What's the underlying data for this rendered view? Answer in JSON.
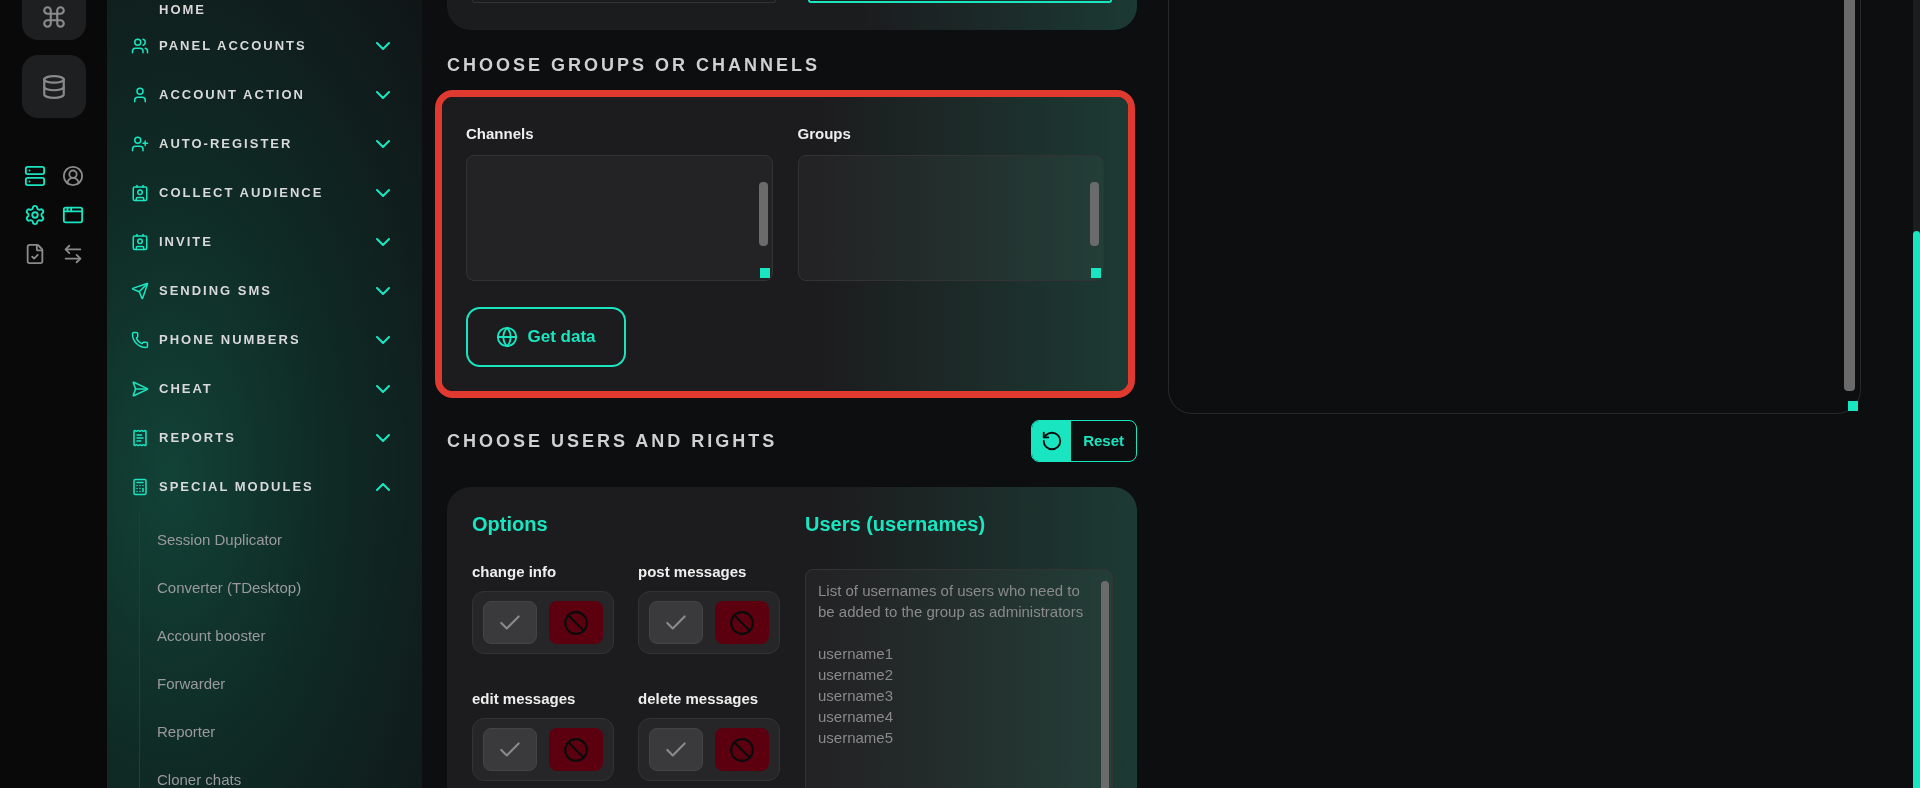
{
  "rail": {
    "tools": [
      {
        "kind": "server",
        "active": true
      },
      {
        "kind": "user",
        "active": false
      },
      {
        "kind": "settings",
        "active": true
      },
      {
        "kind": "code",
        "active": true
      },
      {
        "kind": "document",
        "active": false
      },
      {
        "kind": "swap",
        "active": false
      }
    ]
  },
  "sidebar": {
    "home": "HOME",
    "items": [
      {
        "kind": "users",
        "label": "PANEL ACCOUNTS",
        "expanded": false
      },
      {
        "kind": "user",
        "label": "ACCOUNT ACTION",
        "expanded": false
      },
      {
        "kind": "user-plus",
        "label": "AUTO-REGISTER",
        "expanded": false
      },
      {
        "kind": "audience",
        "label": "COLLECT AUDIENCE",
        "expanded": false
      },
      {
        "kind": "audience",
        "label": "INVITE",
        "expanded": false
      },
      {
        "kind": "send",
        "label": "SENDING SMS",
        "expanded": false
      },
      {
        "kind": "phone",
        "label": "PHONE NUMBERS",
        "expanded": false
      },
      {
        "kind": "send-plus",
        "label": "CHEAT",
        "expanded": false
      },
      {
        "kind": "report",
        "label": "REPORTS",
        "expanded": false
      },
      {
        "kind": "modules",
        "label": "SPECIAL MODULES",
        "expanded": true,
        "children": [
          {
            "label": "Session Duplicator"
          },
          {
            "label": "Converter (TDesktop)"
          },
          {
            "label": "Account booster"
          },
          {
            "label": "Forwarder"
          },
          {
            "label": "Reporter"
          },
          {
            "label": "Cloner chats"
          }
        ]
      }
    ]
  },
  "groups_section": {
    "heading": "CHOOSE GROUPS OR CHANNELS",
    "highlighted": true,
    "fields": [
      {
        "label": "Channels"
      },
      {
        "label": "Groups"
      }
    ],
    "button": "Get data"
  },
  "users_section": {
    "heading": "CHOOSE USERS AND RIGHTS",
    "reset": "Reset",
    "options_title": "Options",
    "options": [
      {
        "label": "change info",
        "allowed": false
      },
      {
        "label": "post messages",
        "allowed": false
      },
      {
        "label": "edit messages",
        "allowed": false
      },
      {
        "label": "delete messages",
        "allowed": false
      }
    ],
    "users_title": "Users (usernames)",
    "users_placeholder": "List of usernames of users who need to be added to the group as administrators\n\nusername1\nusername2\nusername3\nusername4\nusername5"
  }
}
